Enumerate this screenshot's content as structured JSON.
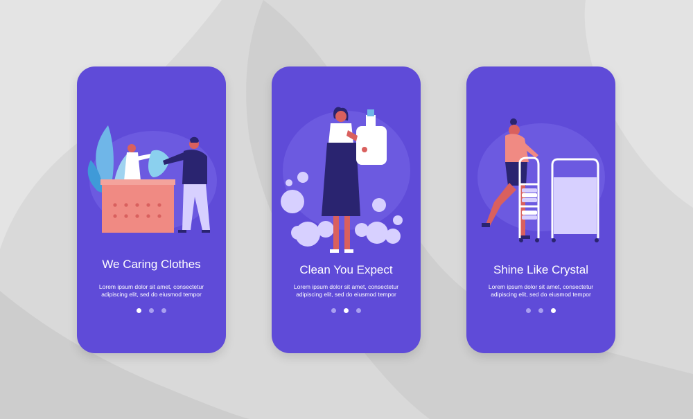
{
  "screens": [
    {
      "title": "We Caring Clothes",
      "description": [
        "Lorem ipsum dolor sit amet, consectetur",
        "adipiscing elit, sed do eiusmod tempor"
      ],
      "active_page": 1
    },
    {
      "title": "Clean You Expect",
      "description": [
        "Lorem ipsum dolor sit amet, consectetur",
        "adipiscing elit, sed do eiusmod tempor"
      ],
      "active_page": 2
    },
    {
      "title": "Shine Like Crystal",
      "description": [
        "Lorem ipsum dolor sit amet, consectetur",
        "adipiscing elit, sed do eiusmod tempor"
      ],
      "active_page": 3
    }
  ],
  "page_count": 3,
  "colors": {
    "background": "#d9d9d9",
    "card": "#5f4bd8",
    "card_blob": "#6c5ae0",
    "basket": "#f08a83",
    "skin": "#d9605e",
    "dark_clothing": "#2a2470",
    "light_clothing": "#ffffff",
    "dot_inactive": "#a99ff0",
    "dot_active": "#ffffff"
  },
  "icons": [
    "laundry-basket-illustration",
    "detergent-bottle-illustration",
    "linen-cart-illustration"
  ]
}
